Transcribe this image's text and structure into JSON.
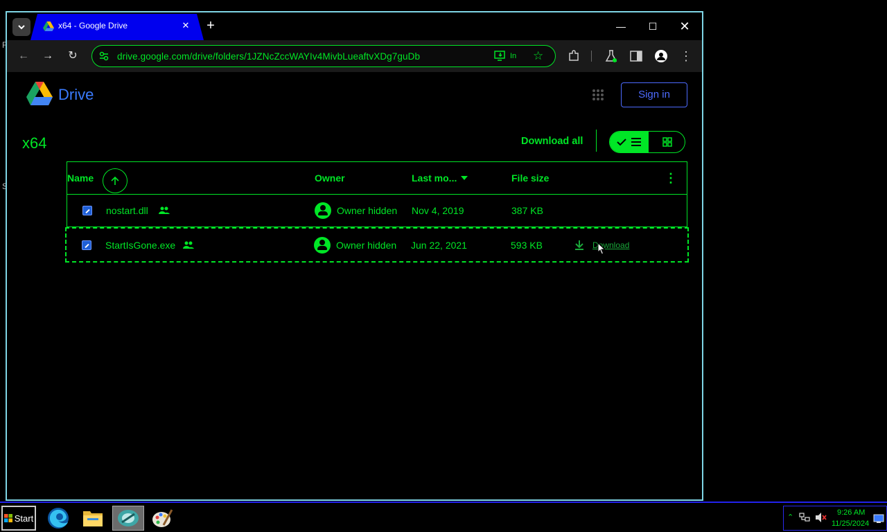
{
  "browser": {
    "tab_title": "x64 - Google Drive",
    "url": "drive.google.com/drive/folders/1JZNcZccWAYIv4MivbLueaftvXDg7guDb",
    "install_label": "In"
  },
  "drive": {
    "brand": "Drive",
    "sign_in_label": "Sign in",
    "folder_title": "x64",
    "download_all_label": "Download all",
    "columns": {
      "name": "Name",
      "owner": "Owner",
      "last_modified": "Last mo...",
      "file_size": "File size"
    },
    "files": [
      {
        "name": "nostart.dll",
        "owner": "Owner hidden",
        "modified": "Nov 4, 2019",
        "size": "387 KB"
      },
      {
        "name": "StartIsGone.exe",
        "owner": "Owner hidden",
        "modified": "Jun 22, 2021",
        "size": "593 KB",
        "action": "Download"
      }
    ]
  },
  "taskbar": {
    "start_label": "Start",
    "time": "9:26 AM",
    "date": "11/25/2024"
  },
  "colors": {
    "accent": "#00e626",
    "tab": "#0000ee",
    "link": "#4d6bff"
  }
}
